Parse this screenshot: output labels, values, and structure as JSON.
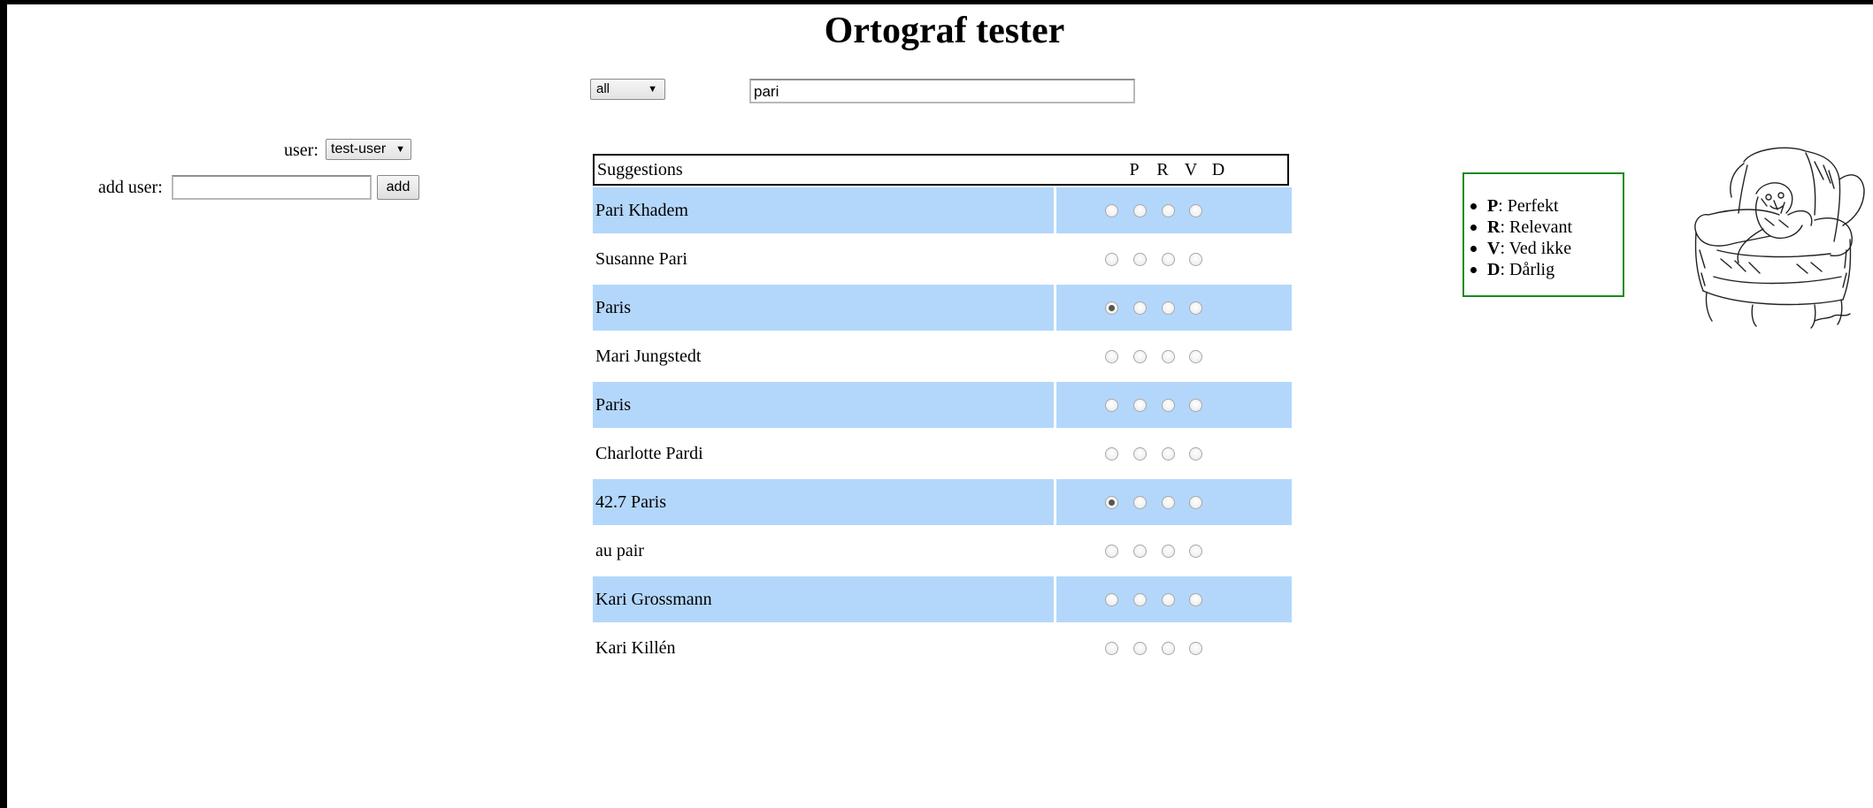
{
  "page": {
    "title": "Ortograf tester"
  },
  "filter": {
    "selected": "all"
  },
  "search": {
    "value": "pari"
  },
  "user": {
    "label": "user:",
    "selected": "test-user"
  },
  "add_user": {
    "label": "add user:",
    "value": "",
    "button_label": "add"
  },
  "table": {
    "header": "Suggestions",
    "columns": [
      "P",
      "R",
      "V",
      "D"
    ],
    "rows": [
      {
        "name": "Pari Khadem",
        "checked": null
      },
      {
        "name": "Susanne Pari",
        "checked": null
      },
      {
        "name": "Paris",
        "checked": "P"
      },
      {
        "name": "Mari Jungstedt",
        "checked": null
      },
      {
        "name": "Paris",
        "checked": null
      },
      {
        "name": "Charlotte Pardi",
        "checked": null
      },
      {
        "name": "42.7 Paris",
        "checked": "P"
      },
      {
        "name": "au pair",
        "checked": null
      },
      {
        "name": "Kari Grossmann",
        "checked": null
      },
      {
        "name": "Kari Killén",
        "checked": null
      }
    ]
  },
  "legend": {
    "items": [
      {
        "key": "P",
        "text": ": Perfekt"
      },
      {
        "key": "R",
        "text": ": Relevant"
      },
      {
        "key": "V",
        "text": ": Ved ikke"
      },
      {
        "key": "D",
        "text": ": Dårlig"
      }
    ],
    "border_color": "#1a8a1a"
  },
  "colors": {
    "row_highlight": "#b3d7fb"
  }
}
